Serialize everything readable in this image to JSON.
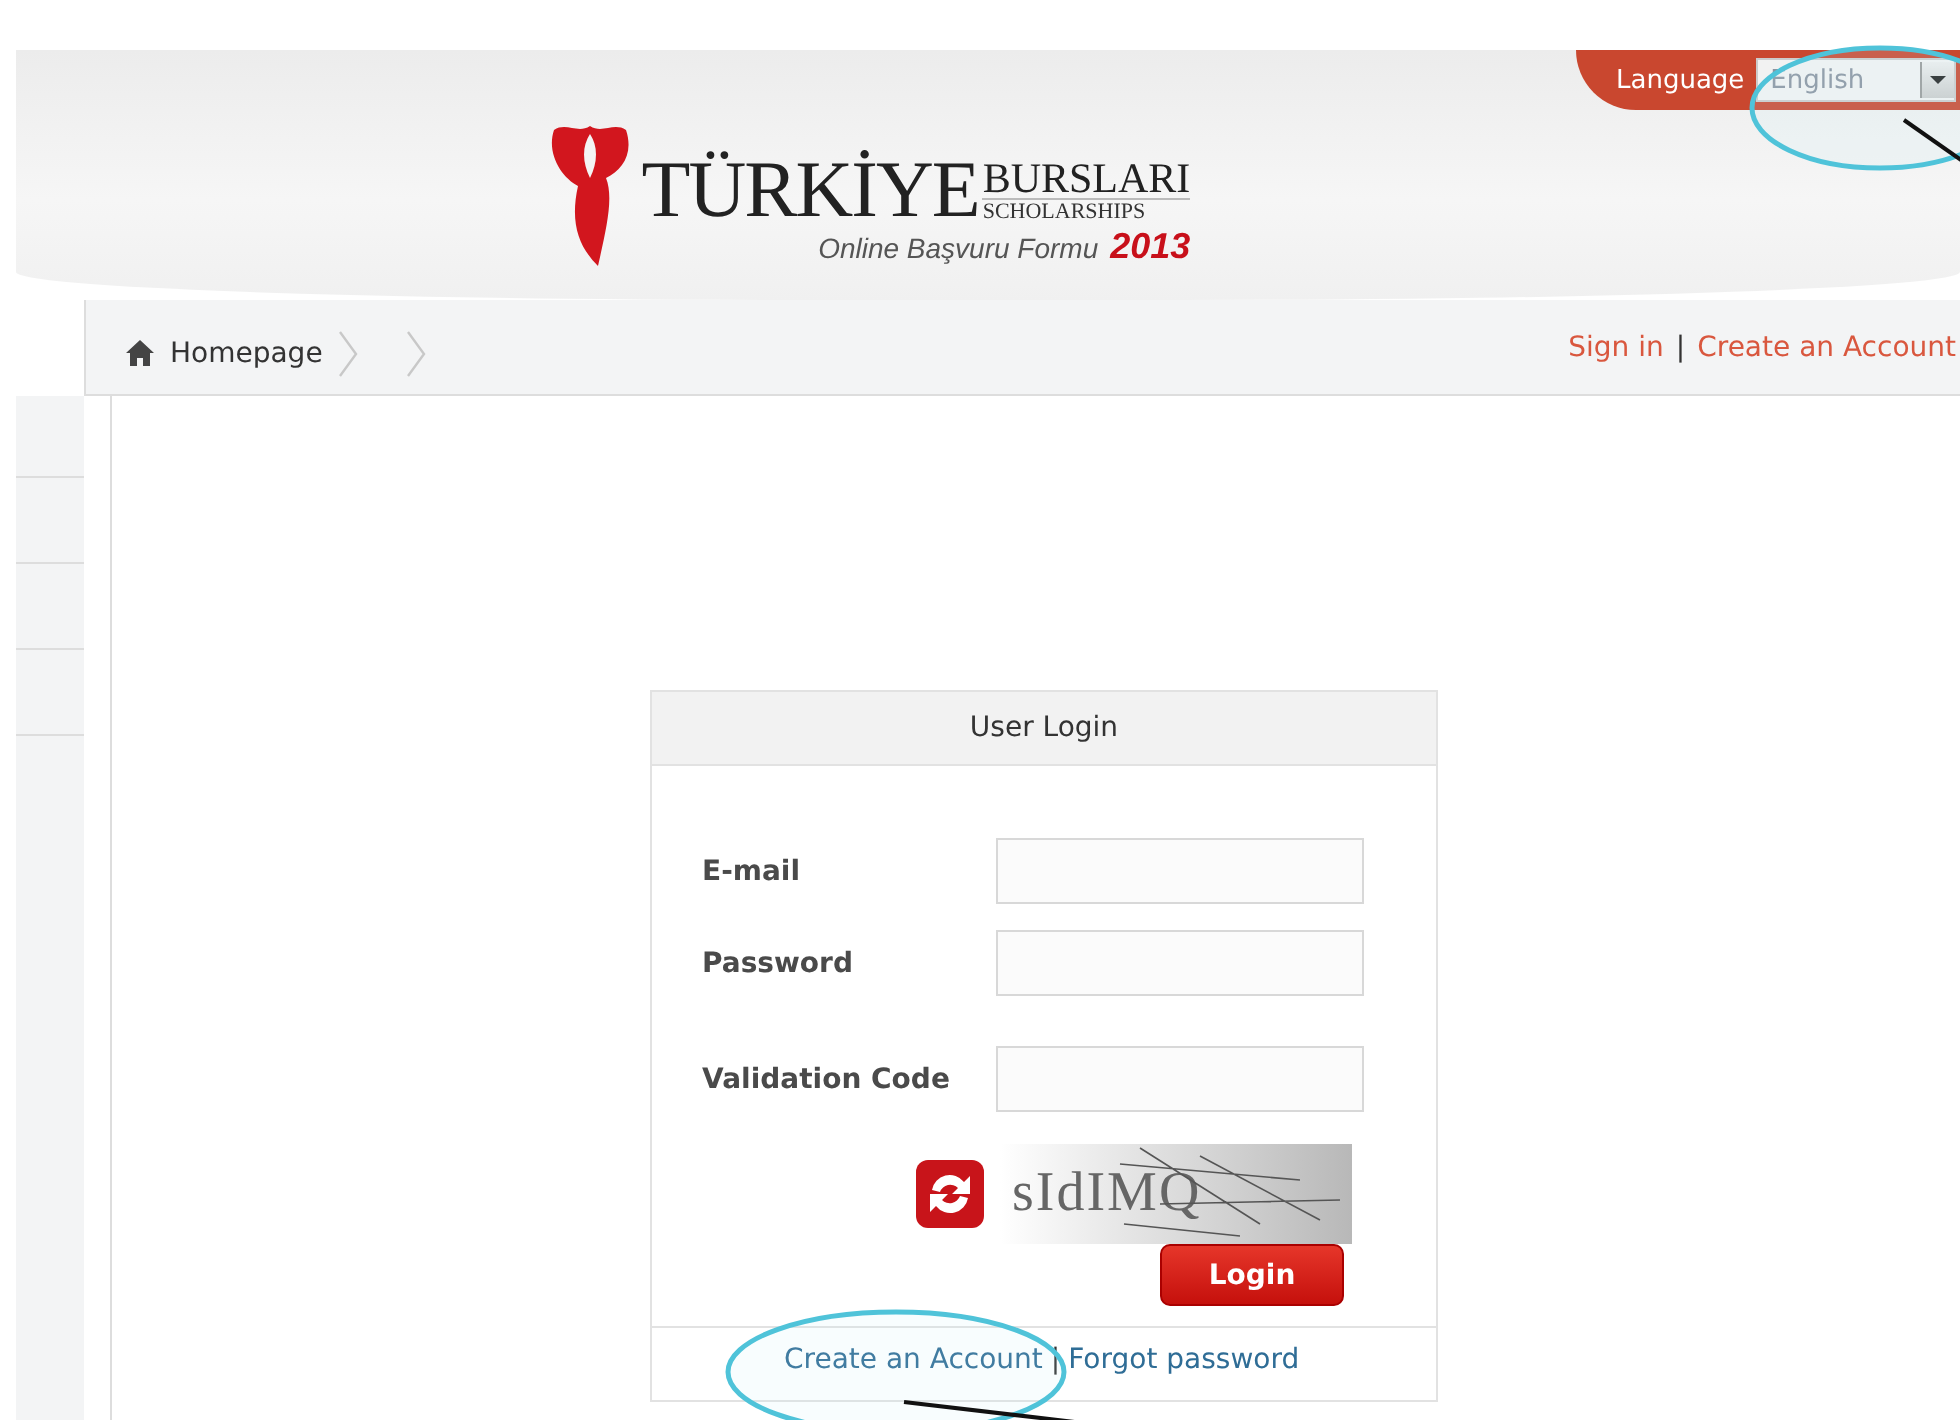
{
  "header": {
    "language_label": "Language",
    "language_value": "English",
    "logo": {
      "title": "TÜRKİYE",
      "subtitle_top": "BURSLARI",
      "subtitle_bottom": "SCHOLARSHIPS",
      "tagline": "Online Başvuru Formu",
      "year": "2013"
    }
  },
  "breadcrumb": [
    {
      "label": "Homepage",
      "kind": "home"
    },
    {
      "kind": "empty"
    }
  ],
  "top_links": {
    "items": [
      "Sign in",
      "Create an Account"
    ],
    "separator": "|"
  },
  "login": {
    "title": "User Login",
    "fields": [
      {
        "label": "E-mail"
      },
      {
        "label": "Password"
      },
      {
        "label": "Validation Code"
      }
    ],
    "captcha": "sIdIMQ",
    "button": "Login",
    "links": [
      "Create an Account",
      "Forgot password"
    ],
    "separator": "|"
  }
}
